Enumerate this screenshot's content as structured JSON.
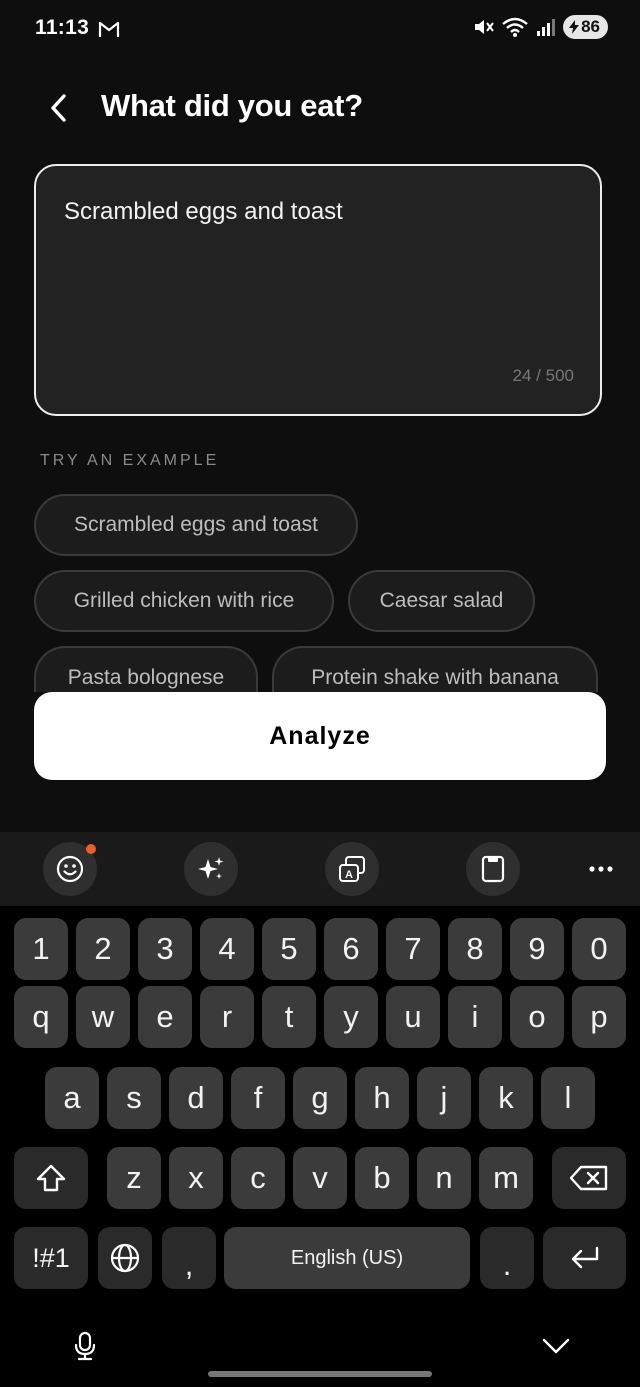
{
  "status_bar": {
    "time": "11:13",
    "battery": "86"
  },
  "header": {
    "title": "What did you eat?"
  },
  "food_input": {
    "value": "Scrambled eggs and toast",
    "counter": "24 / 500"
  },
  "examples": {
    "label": "TRY AN EXAMPLE",
    "chips": [
      "Scrambled eggs and toast",
      "Grilled chicken with rice",
      "Caesar salad",
      "Pasta bolognese",
      "Protein shake with banana"
    ]
  },
  "analyze_button": {
    "label": "Analyze"
  },
  "keyboard": {
    "toolbar_icons": [
      "emoji-icon",
      "sparkle-ai-icon",
      "translate-icon",
      "clipboard-icon",
      "more-icon"
    ],
    "accent_dot_color": "#e8612c",
    "number_row": [
      "1",
      "2",
      "3",
      "4",
      "5",
      "6",
      "7",
      "8",
      "9",
      "0"
    ],
    "row1": [
      "q",
      "w",
      "e",
      "r",
      "t",
      "y",
      "u",
      "i",
      "o",
      "p"
    ],
    "row2": [
      "a",
      "s",
      "d",
      "f",
      "g",
      "h",
      "j",
      "k",
      "l"
    ],
    "row3": [
      "z",
      "x",
      "c",
      "v",
      "b",
      "n",
      "m"
    ],
    "symbols_key": "!#1",
    "comma_key": ",",
    "space_label": "English (US)",
    "period_key": "."
  }
}
